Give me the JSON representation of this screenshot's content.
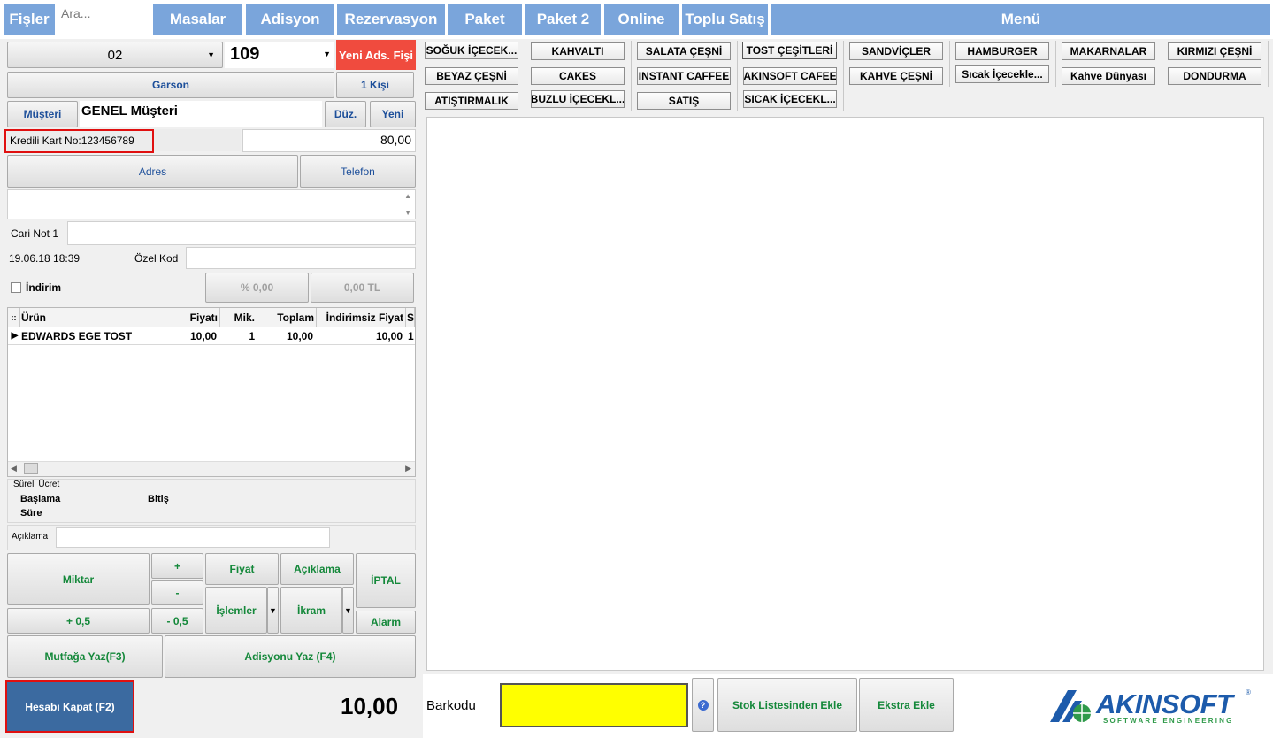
{
  "top_tabs": {
    "fisler": "Fişler",
    "search_placeholder": "Ara...",
    "masalar": "Masalar",
    "adisyon": "Adisyon",
    "rezervasyon": "Rezervasyon",
    "paket": "Paket",
    "paket2": "Paket 2",
    "online": "Online",
    "toplu_satis": "Toplu Satış",
    "menu": "Menü"
  },
  "order": {
    "table_value": "02",
    "adisyon_no": "109",
    "new_receipt_label": "Yeni Ads. Fişi",
    "waiter_label": "Garson",
    "person_count_label": "1 Kişi",
    "customer_button": "Müşteri",
    "customer_name": "GENEL Müşteri",
    "edit_button": "Düz.",
    "new_button": "Yeni",
    "credit_card_text": "Kredili Kart No:123456789",
    "balance_value": "80,00",
    "address_button": "Adres",
    "phone_button": "Telefon",
    "cari_not_label": "Cari Not 1",
    "datetime": "19.06.18 18:39",
    "ozel_kod_label": "Özel Kod",
    "discount_label": "İndirim",
    "discount_percent": "% 0,00",
    "discount_amount": "0,00 TL"
  },
  "items_table": {
    "headers": [
      "Ürün",
      "Fiyatı",
      "Mik.",
      "Toplam",
      "İndirimsiz Fiyat",
      "S"
    ],
    "rows": [
      {
        "urun": "EDWARDS EGE TOST",
        "fiyat": "10,00",
        "miktar": "1",
        "toplam": "10,00",
        "indirimsiz": "10,00",
        "s": "1"
      }
    ]
  },
  "sureli_ucret": {
    "title": "Süreli Ücret",
    "baslama": "Başlama",
    "bitis": "Bitiş",
    "sure": "Süre"
  },
  "aciklama_label": "Açıklama",
  "actions": {
    "miktar": "Miktar",
    "plus": "+",
    "minus": "-",
    "fiyat": "Fiyat",
    "aciklama": "Açıklama",
    "iptal": "İPTAL",
    "islemler": "İşlemler",
    "ikram": "İkram",
    "alarm": "Alarm",
    "plus_half": "+ 0,5",
    "minus_half": "- 0,5",
    "mutfaga_yaz": "Mutfağa Yaz(F3)",
    "adisyonu_yaz": "Adisyonu Yaz (F4)",
    "hesabi_kapat": "Hesabı Kapat (F2)",
    "total": "10,00"
  },
  "categories": [
    "SOĞUK İÇECEK...",
    "KAHVALTI",
    "SALATA ÇEŞNİ",
    "TOST ÇEŞİTLERİ",
    "SANDVİÇLER",
    "HAMBURGER",
    "MAKARNALAR",
    "KIRMIZI ÇEŞNİ",
    "BEYAZ ÇEŞNİ",
    "CAKES",
    "INSTANT CAFFEE",
    "AKINSOFT CAFEE",
    "KAHVE ÇEŞNİ",
    "Sıcak İçecekle...",
    "Kahve Dünyası",
    "DONDURMA",
    "ATIŞTIRMALIK",
    "BUZLU İÇECEKL...",
    "SATIŞ",
    "SICAK İÇECEKL..."
  ],
  "bottom": {
    "barkod_label": "Barkodu",
    "help_icon": "?",
    "stok_listesi": "Stok Listesinden Ekle",
    "ekstra_ekle": "Ekstra Ekle",
    "logo_text": "AKINSOFT",
    "logo_sub": "SOFTWARE ENGINEERING",
    "logo_reg": "®"
  },
  "colors": {
    "tab_blue": "#7aa5db",
    "new_receipt_red": "#f04b3e",
    "close_button_blue": "#3b6aa0",
    "barcode_yellow": "#ffff00",
    "green_text": "#14883a",
    "logo_blue": "#1d5bab"
  }
}
